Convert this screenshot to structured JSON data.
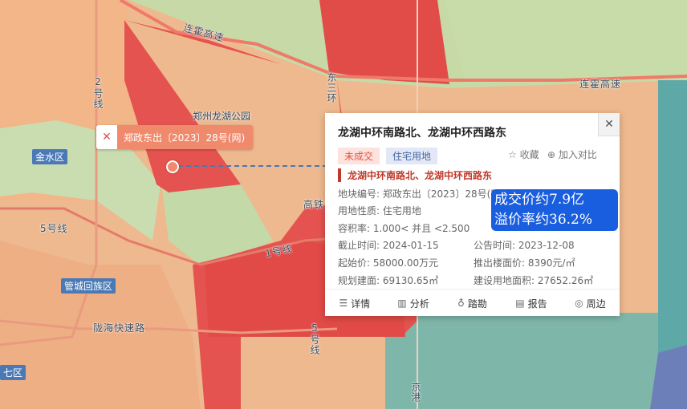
{
  "map": {
    "roads": {
      "lianhuo1": "连霍高速",
      "lianhuo2": "连霍高速",
      "east3": "东三环",
      "line2": "2号线",
      "line5a": "5号线",
      "line1": "1号线",
      "line5b": "5号线",
      "gaotie": "高铁",
      "longhai": "陇海快速路",
      "jinggang": "京港"
    },
    "districts": {
      "jinshui": "金水区",
      "guancheng": "管城回族区",
      "qi": "七区"
    },
    "park": "郑州龙湖公园"
  },
  "marker": {
    "label": "郑政东出〔2023〕28号(网)",
    "icon": "drone-icon"
  },
  "popup": {
    "title": "龙湖中环南路北、龙湖中环西路东",
    "close": "✕",
    "status_tag": "未成交",
    "type_tag": "住宅用地",
    "favorite": "收藏",
    "compare": "加入对比",
    "subtitle": "龙湖中环南路北、龙湖中环西路东",
    "fields": {
      "plot_no": "地块编号: 郑政东出〔2023〕28号(网)",
      "land_use": "用地性质: 住宅用地",
      "far": "容积率: 1.000< 并且 <2.500",
      "deadline": "截止时间: 2024-01-15",
      "announce": "公告时间: 2023-12-08",
      "start_price": "起始价: 58000.00万元",
      "floor_price": "推出楼面价: 8390元/㎡",
      "plan_area": "规划建面: 69130.65㎡",
      "land_area": "建设用地面积: 27652.26㎡"
    },
    "actions": {
      "detail": "详情",
      "analysis": "分析",
      "survey": "踏勘",
      "report": "报告",
      "surroundings": "周边"
    }
  },
  "overlay": {
    "line1": "成交价约7.9亿",
    "line2": "溢价率约36.2%"
  },
  "colors": {
    "red_zone": "#e55350",
    "orange_zone": "#f0aa7c",
    "green_zone": "#c6dba8",
    "teal_zone": "#7fb9ae",
    "accent_blue": "#1a5ee0"
  }
}
